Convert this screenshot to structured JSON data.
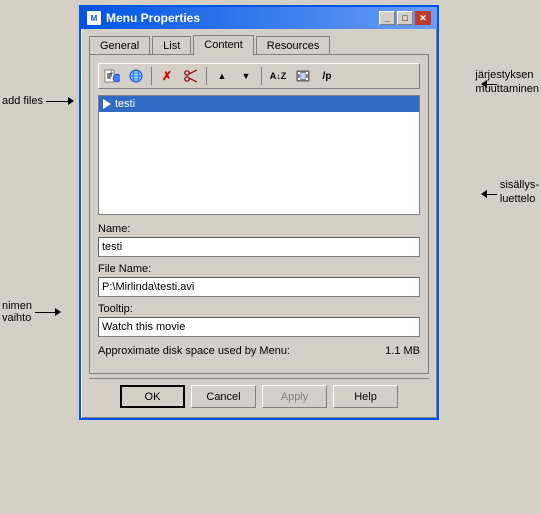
{
  "dialog": {
    "title": "Menu Properties",
    "tabs": [
      {
        "label": "General"
      },
      {
        "label": "List"
      },
      {
        "label": "Content",
        "active": true
      },
      {
        "label": "Resources"
      }
    ],
    "toolbar": {
      "buttons": [
        {
          "name": "add-file",
          "icon": "📄",
          "tooltip": "Add file"
        },
        {
          "name": "add-web",
          "icon": "🌐",
          "tooltip": "Add web"
        },
        {
          "name": "delete",
          "icon": "✗",
          "tooltip": "Delete"
        },
        {
          "name": "cut",
          "icon": "✂",
          "tooltip": "Cut"
        },
        {
          "name": "move-up",
          "icon": "▲",
          "tooltip": "Move up"
        },
        {
          "name": "move-down",
          "icon": "▼",
          "tooltip": "Move down"
        },
        {
          "name": "sort-az",
          "icon": "A↓Z",
          "tooltip": "Sort A-Z"
        },
        {
          "name": "film",
          "icon": "🎞",
          "tooltip": "Film"
        },
        {
          "name": "slash-p",
          "icon": "/p",
          "tooltip": "/p"
        }
      ]
    },
    "list_items": [
      {
        "label": "testi",
        "selected": true
      }
    ],
    "fields": {
      "name_label": "Name:",
      "name_value": "testi",
      "filename_label": "File Name:",
      "filename_value": "P:\\Mirlinda\\testi.avi",
      "tooltip_label": "Tooltip:",
      "tooltip_value": "Watch this movie"
    },
    "disk_space_label": "Approximate disk space used by Menu:",
    "disk_space_value": "1.1 MB",
    "buttons": {
      "ok": "OK",
      "cancel": "Cancel",
      "apply": "Apply",
      "help": "Help"
    }
  },
  "annotations": {
    "add_files": "add files",
    "order_change": "järjestyksen\nmuuttaminen",
    "content_list": "sisällys-\nluettelo",
    "name_change": "nimen\nvaihto"
  }
}
